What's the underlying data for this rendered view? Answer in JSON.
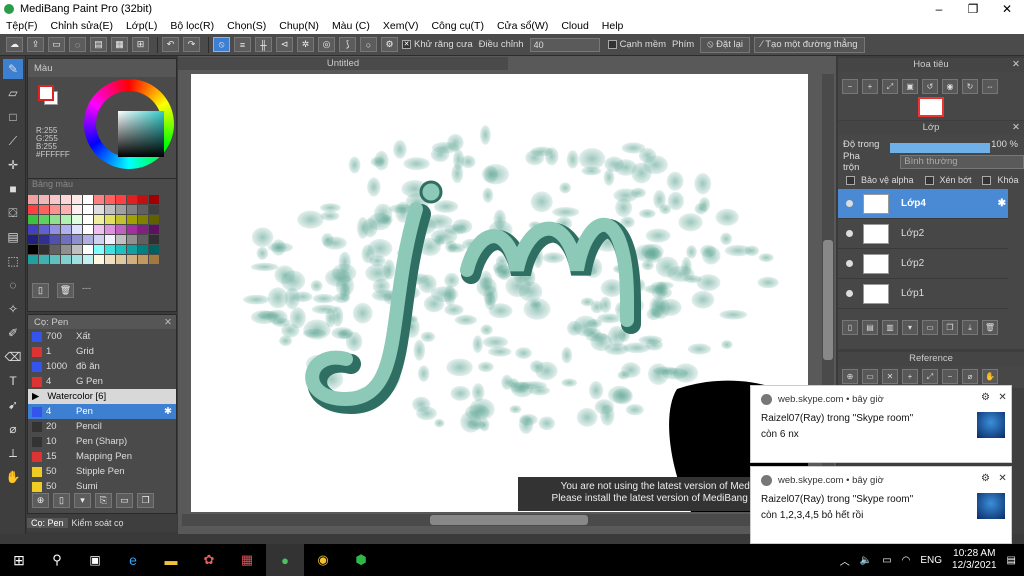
{
  "window": {
    "title": "MediBang Paint Pro (32bit)",
    "controls": [
      "–",
      "❐",
      "✕"
    ]
  },
  "menu": [
    "Tệp(F)",
    "Chỉnh sửa(E)",
    "Lớp(L)",
    "Bộ lọc(R)",
    "Chọn(S)",
    "Chụp(N)",
    "Màu (C)",
    "Xem(V)",
    "Công cụ(T)",
    "Cửa sổ(W)",
    "Cloud",
    "Help"
  ],
  "toolbar": {
    "antialias_label": "Khử răng cưa",
    "adjust_label": "Điều chỉnh",
    "adjust_value": "40",
    "edge_label": "Cạnh mềm",
    "key_label": "Phím",
    "reset_label": "Đặt lại",
    "straight_line_label": "Tạo một đường thẳng"
  },
  "color_panel": {
    "title": "Màu",
    "r": "R:255",
    "g": "G:255",
    "b": "B:255",
    "hex": "#FFFFFF",
    "primary_color": "#ffffff",
    "accent_color": "#d22222"
  },
  "palette_panel": {
    "title": "Bảng màu",
    "more_label": "---"
  },
  "brush_panel": {
    "title": "Cọ: Pen",
    "items": [
      {
        "size": "700",
        "name": "Xất",
        "color": "#3355ee"
      },
      {
        "size": "1",
        "name": "Grid",
        "color": "#dd3333"
      },
      {
        "size": "1000",
        "name": "đồ ăn",
        "color": "#3355ee"
      },
      {
        "size": "4",
        "name": "G Pen",
        "color": "#dd3333"
      }
    ],
    "group_label": "Watercolor [6]",
    "group_items": [
      {
        "size": "4",
        "name": "Pen",
        "color": "#3355ee",
        "selected": true
      },
      {
        "size": "20",
        "name": "Pencil",
        "color": "#333333"
      },
      {
        "size": "10",
        "name": "Pen (Sharp)",
        "color": "#333333"
      },
      {
        "size": "15",
        "name": "Mapping Pen",
        "color": "#dd3333"
      },
      {
        "size": "50",
        "name": "Stipple Pen",
        "color": "#eecc22"
      },
      {
        "size": "50",
        "name": "Sumi",
        "color": "#eecc22"
      }
    ],
    "tabs": [
      "Cọ: Pen",
      "Kiểm soát cọ"
    ]
  },
  "canvas": {
    "doc_title": "Untitled",
    "notice_line1": "You are not using the latest version of MediBang",
    "notice_line2": "Please install the latest version of MediBang Paint fo"
  },
  "navigator": {
    "title": "Hoa tiêu"
  },
  "layers": {
    "title": "Lớp",
    "opacity_label": "Độ trong",
    "opacity_value": "100 %",
    "blend_label": "Pha trộn",
    "blend_value": "Bình thường",
    "protect_alpha": "Bảo vệ alpha",
    "clipping": "Xén bớt",
    "lock": "Khóa",
    "items": [
      {
        "name": "Lớp4",
        "selected": true
      },
      {
        "name": "Lớp2",
        "selected": false
      },
      {
        "name": "Lớp2",
        "selected": false
      },
      {
        "name": "Lớp1",
        "selected": false
      }
    ]
  },
  "reference": {
    "title": "Reference"
  },
  "notifications": [
    {
      "source": "web.skype.com",
      "time": "bây giờ",
      "title": "Raizel07(Ray) trong \"Skype room\"",
      "body": "còn 6 nx"
    },
    {
      "source": "web.skype.com",
      "time": "bây giờ",
      "title": "Raizel07(Ray) trong \"Skype room\"",
      "body": "còn 1,2,3,4,5 bỏ hết rồi"
    }
  ],
  "taskbar": {
    "time": "10:28 AM",
    "date": "12/3/2021",
    "lang": "ENG"
  }
}
